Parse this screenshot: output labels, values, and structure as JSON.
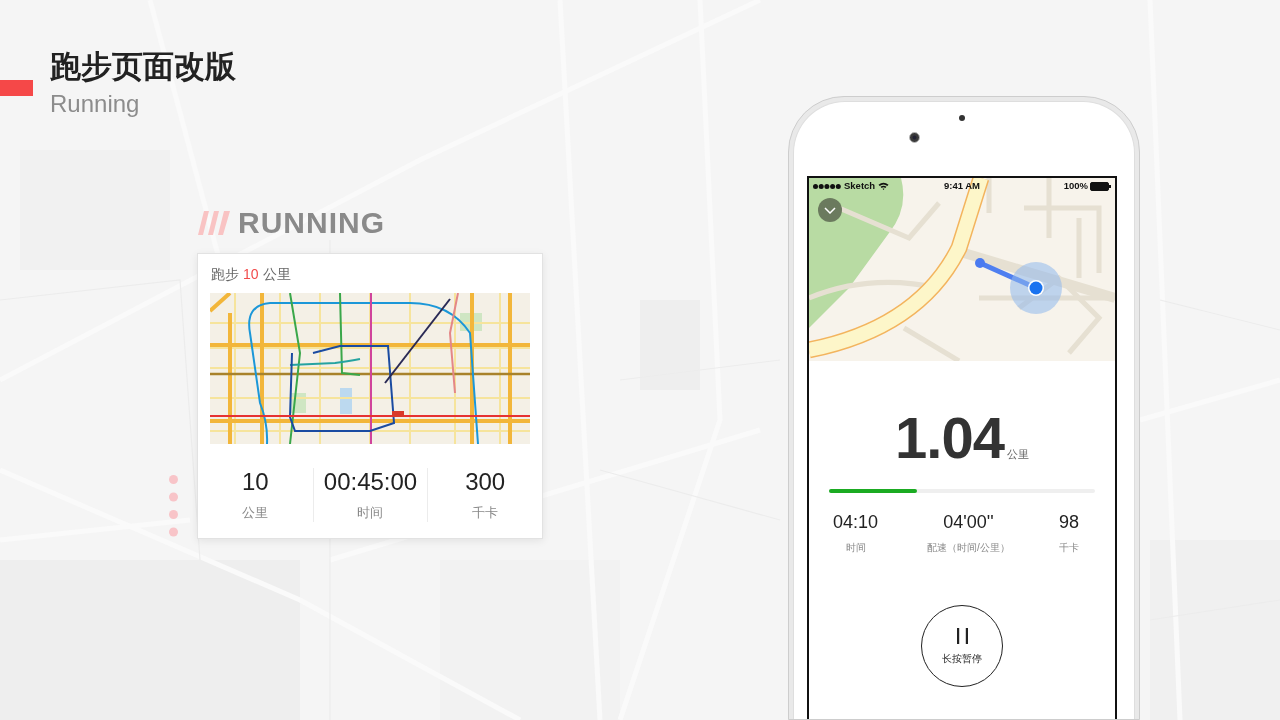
{
  "header": {
    "title": "跑步页面改版",
    "subtitle": "Running"
  },
  "section_label": "RUNNING",
  "card": {
    "title": {
      "prefix": "跑步",
      "highlight": "10",
      "suffix": "公里"
    },
    "stats": [
      {
        "value": "10",
        "label": "公里"
      },
      {
        "value": "00:45:00",
        "label": "时间"
      },
      {
        "value": "300",
        "label": "千卡"
      }
    ]
  },
  "phone": {
    "status_bar": {
      "carrier": "Sketch",
      "time": "9:41 AM",
      "battery": "100%"
    },
    "distance": {
      "value": "1.04",
      "unit": "公里"
    },
    "progress": {
      "level": 0.33
    },
    "stats": [
      {
        "value": "04:10",
        "label": "时间"
      },
      {
        "value": "04'00''",
        "label": "配速（时间/公里）"
      },
      {
        "value": "98",
        "label": "千卡"
      }
    ],
    "pause_button": {
      "label": "长按暂停"
    }
  }
}
